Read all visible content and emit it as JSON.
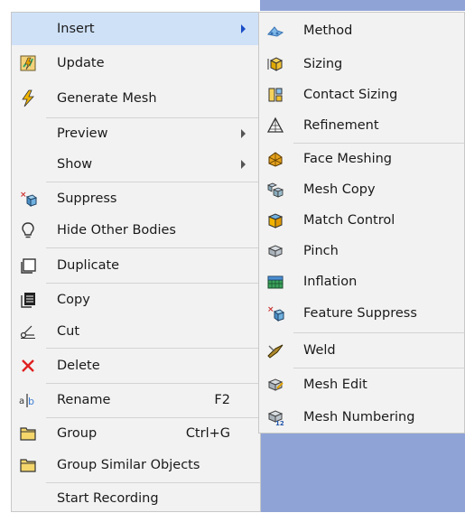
{
  "main_menu": {
    "items": [
      {
        "id": "insert",
        "label": "Insert",
        "submenu": true,
        "highlighted": true
      },
      {
        "id": "update",
        "label": "Update",
        "icon": "update-icon"
      },
      {
        "id": "generate-mesh",
        "label": "Generate Mesh",
        "icon": "lightning-icon"
      },
      {
        "id": "preview",
        "label": "Preview",
        "submenu": true
      },
      {
        "id": "show",
        "label": "Show",
        "submenu": true
      },
      {
        "id": "suppress",
        "label": "Suppress",
        "icon": "suppress-icon"
      },
      {
        "id": "hide-other-bodies",
        "label": "Hide Other Bodies",
        "icon": "lightbulb-icon"
      },
      {
        "id": "duplicate",
        "label": "Duplicate",
        "icon": "duplicate-icon"
      },
      {
        "id": "copy",
        "label": "Copy",
        "icon": "copy-icon"
      },
      {
        "id": "cut",
        "label": "Cut",
        "icon": "scissors-icon"
      },
      {
        "id": "delete",
        "label": "Delete",
        "icon": "delete-x-icon"
      },
      {
        "id": "rename",
        "label": "Rename",
        "shortcut": "F2",
        "icon": "rename-icon"
      },
      {
        "id": "group",
        "label": "Group",
        "shortcut": "Ctrl+G",
        "icon": "folder-icon"
      },
      {
        "id": "group-similar",
        "label": "Group Similar Objects",
        "icon": "folder-icon"
      },
      {
        "id": "start-recording",
        "label": "Start Recording"
      }
    ]
  },
  "insert_submenu": {
    "items": [
      {
        "id": "method",
        "label": "Method",
        "icon": "method-icon"
      },
      {
        "id": "sizing",
        "label": "Sizing",
        "icon": "sizing-icon"
      },
      {
        "id": "contact-sizing",
        "label": "Contact Sizing",
        "icon": "contact-sizing-icon"
      },
      {
        "id": "refinement",
        "label": "Refinement",
        "icon": "refinement-icon"
      },
      {
        "id": "face-meshing",
        "label": "Face Meshing",
        "icon": "face-meshing-icon"
      },
      {
        "id": "mesh-copy",
        "label": "Mesh Copy",
        "icon": "mesh-copy-icon"
      },
      {
        "id": "match-control",
        "label": "Match Control",
        "icon": "match-control-icon"
      },
      {
        "id": "pinch",
        "label": "Pinch",
        "icon": "pinch-icon"
      },
      {
        "id": "inflation",
        "label": "Inflation",
        "icon": "inflation-icon"
      },
      {
        "id": "feature-suppress",
        "label": "Feature Suppress",
        "icon": "feature-suppress-icon"
      },
      {
        "id": "weld",
        "label": "Weld",
        "icon": "weld-icon"
      },
      {
        "id": "mesh-edit",
        "label": "Mesh Edit",
        "icon": "mesh-edit-icon"
      },
      {
        "id": "mesh-numbering",
        "label": "Mesh Numbering",
        "icon": "mesh-numbering-icon"
      }
    ]
  },
  "colors": {
    "highlight": "#cfe1f7",
    "menu_bg": "#f2f2f2",
    "viewport_blue": "#8fa3d6",
    "delete_red": "#e02020"
  }
}
